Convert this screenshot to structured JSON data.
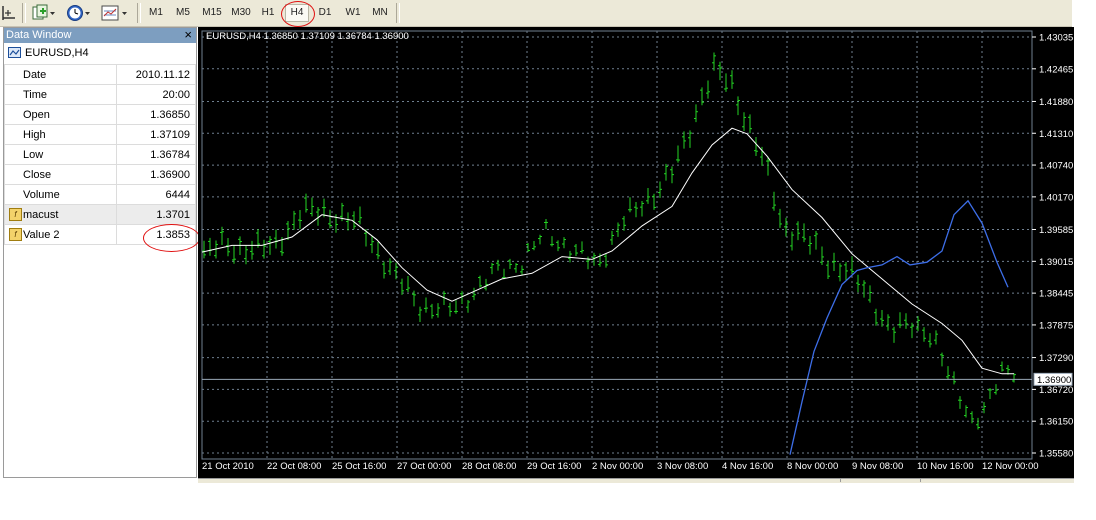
{
  "toolbar": {
    "timeframes": [
      "M1",
      "M5",
      "M15",
      "M30",
      "H1",
      "H4",
      "D1",
      "W1",
      "MN"
    ],
    "active_timeframe": "H4",
    "icons": [
      "crosshair-icon",
      "new-order-icon",
      "clock-icon",
      "chart-type-icon"
    ]
  },
  "data_window": {
    "title": "Data Window",
    "close_glyph": "×",
    "symbol": "EURUSD,H4",
    "rows": [
      {
        "label": "Date",
        "value": "2010.11.12"
      },
      {
        "label": "Time",
        "value": "20:00"
      },
      {
        "label": "Open",
        "value": "1.36850"
      },
      {
        "label": "High",
        "value": "1.37109"
      },
      {
        "label": "Low",
        "value": "1.36784"
      },
      {
        "label": "Close",
        "value": "1.36900"
      },
      {
        "label": "Volume",
        "value": "6444"
      },
      {
        "label": "macust",
        "value": "1.3701",
        "icon": "indicator-icon"
      },
      {
        "label": "Value 2",
        "value": "1.3853",
        "icon": "indicator-icon"
      }
    ]
  },
  "chart": {
    "header": "EURUSD,H4  1.36850 1.37109 1.36784 1.36900",
    "price_labels": [
      "1.43035",
      "1.42465",
      "1.41880",
      "1.41310",
      "1.40740",
      "1.40170",
      "1.39585",
      "1.39015",
      "1.38445",
      "1.37875",
      "1.37290",
      "1.36720",
      "1.36150",
      "1.35580"
    ],
    "current_price": "1.36900",
    "time_labels": [
      "21 Oct 2010",
      "22 Oct 08:00",
      "25 Oct 16:00",
      "27 Oct 00:00",
      "28 Oct 08:00",
      "29 Oct 16:00",
      "2 Nov 00:00",
      "3 Nov 08:00",
      "4 Nov 16:00",
      "8 Nov 00:00",
      "9 Nov 08:00",
      "10 Nov 16:00",
      "12 Nov 00:00"
    ],
    "colors": {
      "background": "#000000",
      "grid": "#6f7f8f",
      "bars": "#23d323",
      "ma_line": "#ffffff",
      "value2_line": "#3d6ee8",
      "text": "#ffffff"
    }
  }
}
